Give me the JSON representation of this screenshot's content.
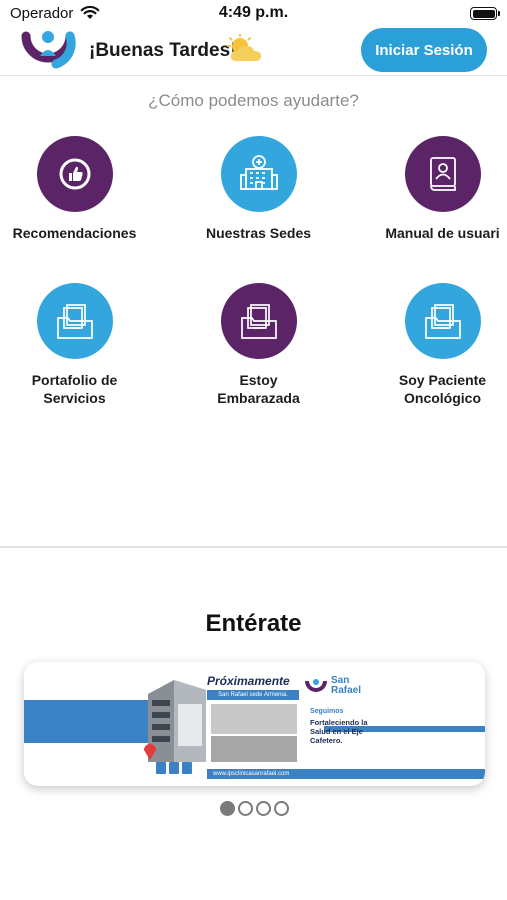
{
  "status_bar": {
    "carrier": "Operador",
    "time": "4:49 p.m."
  },
  "header": {
    "greeting": "¡Buenas Tardes!",
    "login_label": "Iniciar Sesión"
  },
  "help": {
    "title": "¿Cómo podemos ayudarte?",
    "items": [
      {
        "label": "Recomendaciones",
        "icon": "thumbs-up-icon",
        "color": "#5b2467"
      },
      {
        "label": "Nuestras Sedes",
        "icon": "hospital-icon",
        "color": "#33a6dd"
      },
      {
        "label": "Manual de usuari",
        "icon": "user-manual-icon",
        "color": "#5b2467"
      },
      {
        "label_1": "Portafolio de",
        "label_2": "Servicios",
        "icon": "folder-icon",
        "color": "#33a6dd"
      },
      {
        "label_1": "Estoy",
        "label_2": "Embarazada",
        "icon": "folder-icon",
        "color": "#5b2467"
      },
      {
        "label_1": "Soy Paciente",
        "label_2": "Oncológico",
        "icon": "folder-icon",
        "color": "#33a6dd"
      }
    ]
  },
  "news": {
    "title": "Entérate",
    "banner": {
      "heading": "Próximamente",
      "subheading": "San Rafael sede Armenia.",
      "brand_1": "San",
      "brand_2": "Rafael",
      "tagline": "Seguimos",
      "message": "Fortaleciendo la Salud en el Eje Cafetero.",
      "url": "www.ipsclinicasanrafael.com"
    },
    "carousel_total": 4,
    "carousel_active": 1
  },
  "colors": {
    "purple": "#5b2467",
    "blue": "#33a6dd",
    "button": "#2a9fd8"
  }
}
